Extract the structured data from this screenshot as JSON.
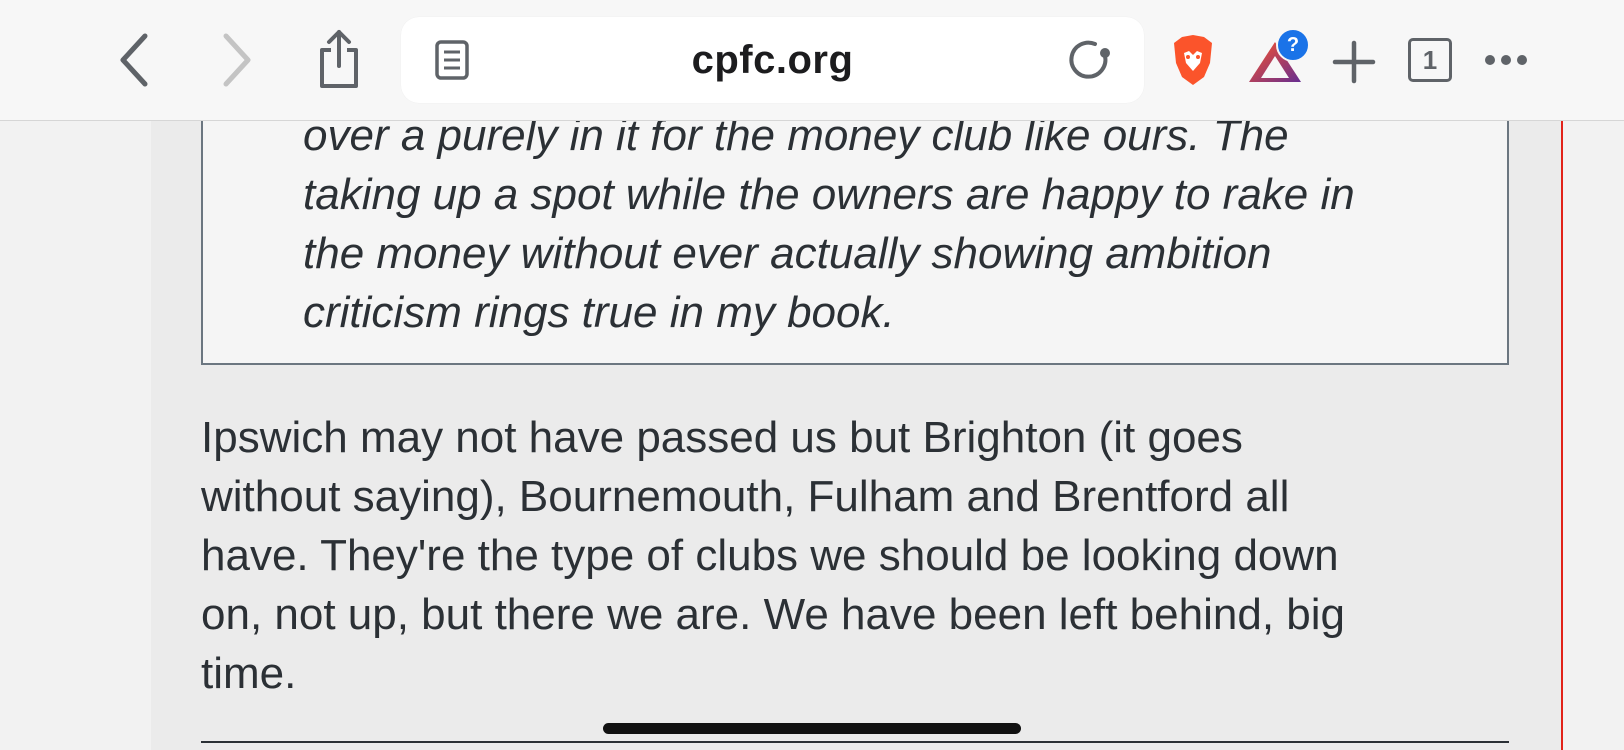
{
  "browser": {
    "url": "cpfc.org",
    "tab_count": "1",
    "rewards_badge": "?",
    "icons": {
      "back": "chevron-left-icon",
      "forward": "chevron-right-icon",
      "share": "share-icon",
      "reader": "reader-mode-icon",
      "reload": "reload-icon",
      "brave": "brave-lion-icon",
      "rewards": "brave-rewards-icon",
      "new_tab": "plus-icon",
      "tabs": "tabs-icon",
      "more": "more-icon"
    },
    "colors": {
      "brave_orange": "#fb542b",
      "rewards_purple": "#662d91",
      "accent_red": "#e2231a"
    }
  },
  "article": {
    "quote_lines": [
      "over a purely in it for the money club like ours. The",
      "taking up a spot while the owners are happy to rake in",
      "the money without ever actually showing ambition",
      "criticism rings true in my book."
    ],
    "paragraph_lines": [
      "Ipswich may not have passed us but Brighton (it goes",
      "without saying), Bournemouth, Fulham and Brentford all",
      "have. They're the type of clubs we should be looking down",
      "on, not up, but there we are. We have been left behind, big",
      "time."
    ]
  }
}
